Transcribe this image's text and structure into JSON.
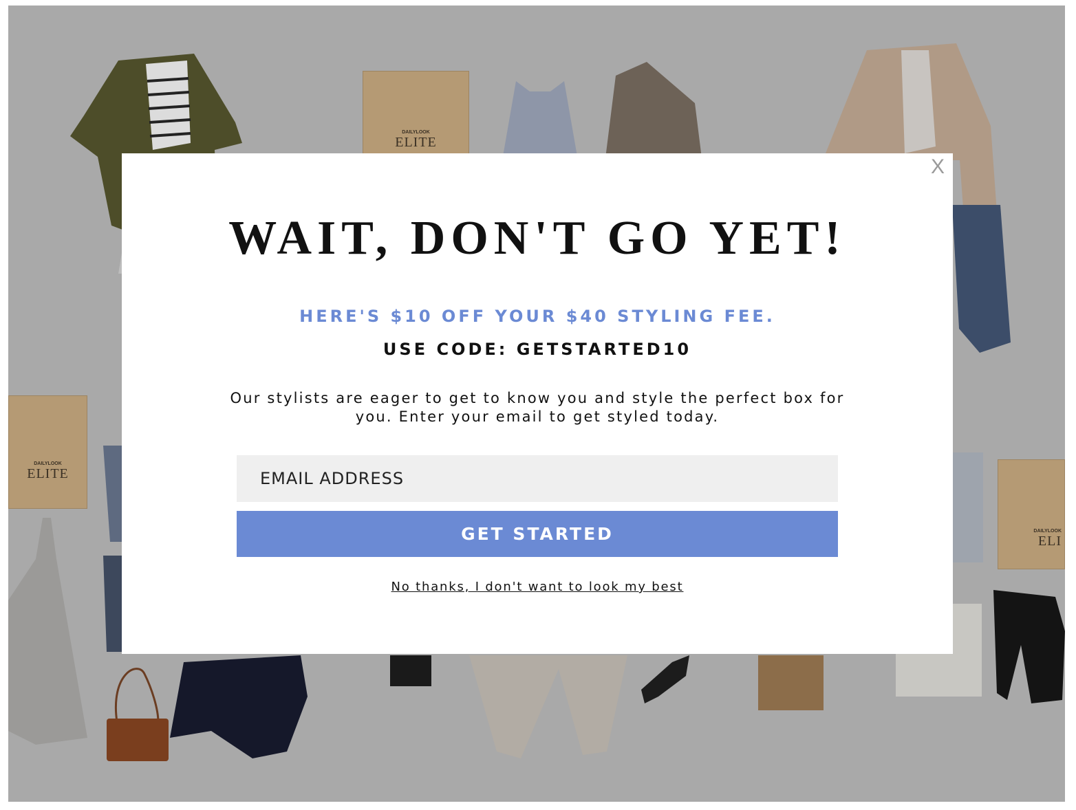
{
  "background": {
    "box_brand_small": "DAILYLOOK",
    "box_brand_big": "ELITE",
    "box_brand_big_cropped": "ELITE",
    "box_brand_big_right": "ELI"
  },
  "modal": {
    "close_label": "X",
    "headline": "WAIT, DON'T GO YET!",
    "offer_text": "HERE'S $10 OFF YOUR $40 STYLING FEE.",
    "code_text": "USE CODE: GETSTARTED10",
    "description": "Our stylists are eager to get to know you and style the perfect box for you. Enter your email to get styled today.",
    "email": {
      "placeholder": "EMAIL ADDRESS",
      "value": ""
    },
    "cta_label": "GET STARTED",
    "decline_label": "No thanks, I don't want to look my best"
  },
  "colors": {
    "accent": "#6b8ad4",
    "overlay": "#a9a9a9",
    "text": "#111111"
  }
}
